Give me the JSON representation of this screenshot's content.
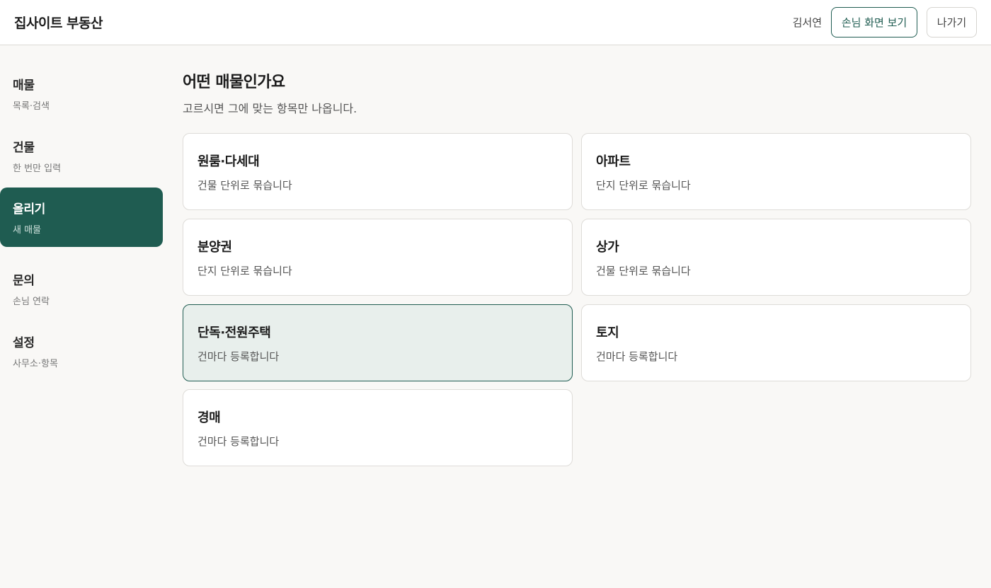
{
  "header": {
    "brand": "집사이트 부동산",
    "user_name": "김서연",
    "customer_view_label": "손님 화면 보기",
    "exit_label": "나가기"
  },
  "sidebar": {
    "items": [
      {
        "title": "매물",
        "sub": "목록·검색",
        "active": false
      },
      {
        "title": "건물",
        "sub": "한 번만 입력",
        "active": false
      },
      {
        "title": "올리기",
        "sub": "새 매물",
        "active": true
      },
      {
        "title": "문의",
        "sub": "손님 연락",
        "active": false
      },
      {
        "title": "설정",
        "sub": "사무소·항목",
        "active": false
      }
    ]
  },
  "main": {
    "title": "어떤 매물인가요",
    "description": "고르시면 그에 맞는 항목만 나옵니다.",
    "options": [
      {
        "title": "원룸·다세대",
        "sub": "건물 단위로 묶습니다",
        "selected": false
      },
      {
        "title": "아파트",
        "sub": "단지 단위로 묶습니다",
        "selected": false
      },
      {
        "title": "분양권",
        "sub": "단지 단위로 묶습니다",
        "selected": false
      },
      {
        "title": "상가",
        "sub": "건물 단위로 묶습니다",
        "selected": false
      },
      {
        "title": "단독·전원주택",
        "sub": "건마다 등록합니다",
        "selected": true
      },
      {
        "title": "토지",
        "sub": "건마다 등록합니다",
        "selected": false
      },
      {
        "title": "경매",
        "sub": "건마다 등록합니다",
        "selected": false
      }
    ]
  },
  "colors": {
    "accent": "#1f5c51",
    "selected_bg": "#e8efec",
    "page_bg": "#f9f8f6"
  }
}
